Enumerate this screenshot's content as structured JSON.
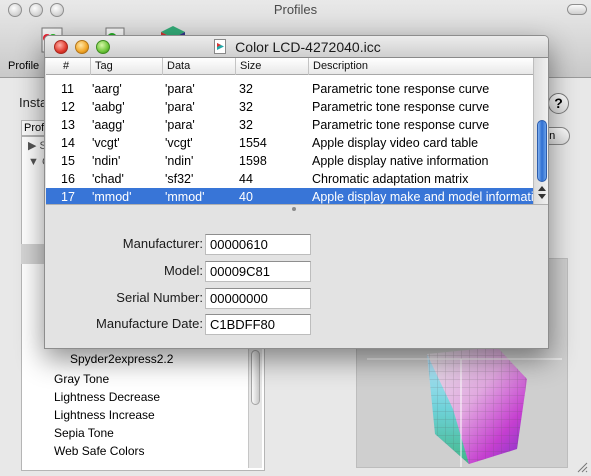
{
  "background_window": {
    "title": "Profiles",
    "toolbar_label": "Profile",
    "install_label": "Insta",
    "help_label": "?",
    "open_label": "en",
    "list_header": "Profi",
    "tree_rows": [
      {
        "arrow": "▶",
        "text": "S"
      },
      {
        "arrow": "▼",
        "text": "C"
      }
    ],
    "list_items": [
      {
        "label": "Spyder2express2.2",
        "sub": true
      },
      {
        "label": "Gray Tone"
      },
      {
        "label": "Lightness Decrease"
      },
      {
        "label": "Lightness Increase"
      },
      {
        "label": "Sepia Tone"
      },
      {
        "label": "Web Safe Colors"
      }
    ]
  },
  "window": {
    "title": "Color LCD-4272040.icc"
  },
  "table": {
    "columns": [
      "#",
      "Tag",
      "Data",
      "Size",
      "Description"
    ],
    "rows": [
      {
        "num": "11",
        "tag": "'aarg'",
        "data": "'para'",
        "size": "32",
        "desc": "Parametric tone response curve"
      },
      {
        "num": "12",
        "tag": "'aabg'",
        "data": "'para'",
        "size": "32",
        "desc": "Parametric tone response curve"
      },
      {
        "num": "13",
        "tag": "'aagg'",
        "data": "'para'",
        "size": "32",
        "desc": "Parametric tone response curve"
      },
      {
        "num": "14",
        "tag": "'vcgt'",
        "data": "'vcgt'",
        "size": "1554",
        "desc": "Apple display video card table"
      },
      {
        "num": "15",
        "tag": "'ndin'",
        "data": "'ndin'",
        "size": "1598",
        "desc": "Apple display native information"
      },
      {
        "num": "16",
        "tag": "'chad'",
        "data": "'sf32'",
        "size": "44",
        "desc": "Chromatic adaptation matrix"
      },
      {
        "num": "17",
        "tag": "'mmod'",
        "data": "'mmod'",
        "size": "40",
        "desc": "Apple display make and model information",
        "selected": true
      }
    ]
  },
  "details": {
    "manufacturer_label": "Manufacturer:",
    "manufacturer_value": "00000610",
    "model_label": "Model:",
    "model_value": "00009C81",
    "serial_label": "Serial Number:",
    "serial_value": "00000000",
    "date_label": "Manufacture Date:",
    "date_value": "C1BDFF80"
  },
  "colors": {
    "selection": "#3875d7",
    "close": "#e03b2e",
    "minimize": "#f2a628",
    "zoom": "#6ec63a"
  }
}
